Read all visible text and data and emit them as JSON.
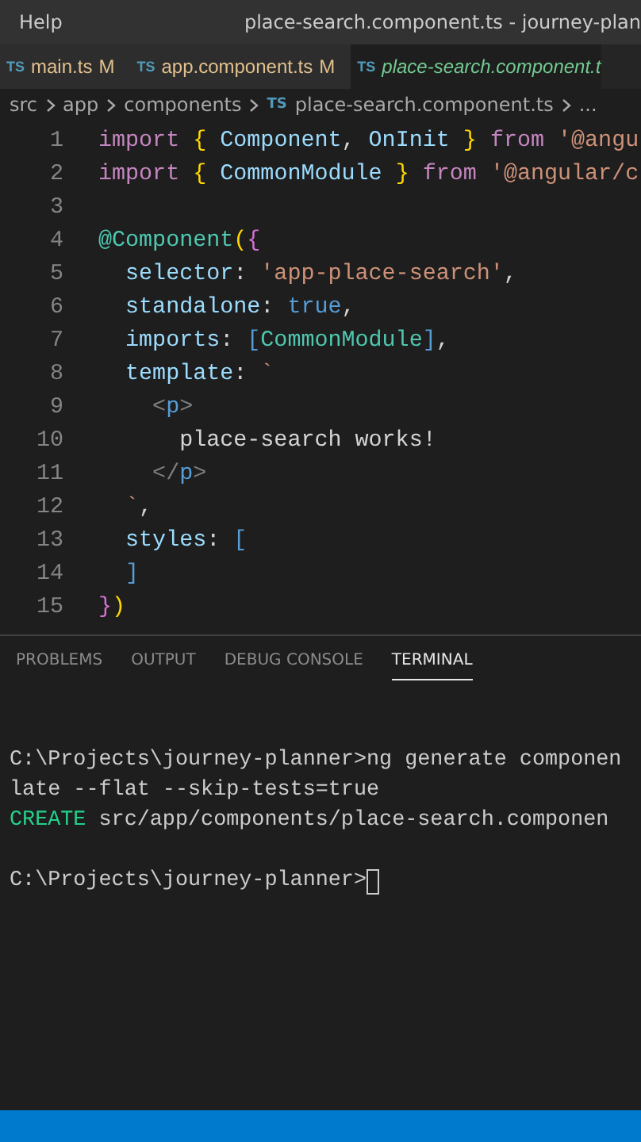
{
  "title_bar": {
    "menu": "Help",
    "title": "place-search.component.ts - journey-plan"
  },
  "tabs": [
    {
      "icon": "TS",
      "label": "main.ts",
      "badge": "M",
      "selected": false,
      "modified": true
    },
    {
      "icon": "TS",
      "label": "app.component.ts",
      "badge": "M",
      "selected": false,
      "modified": true
    },
    {
      "icon": "TS",
      "label": "place-search.component.t",
      "selected": true,
      "modified": false
    }
  ],
  "breadcrumb": {
    "parts": [
      "src",
      "app",
      "components"
    ],
    "file_icon": "TS",
    "file": "place-search.component.ts",
    "more": "..."
  },
  "editor": {
    "lines": [
      {
        "number": "1",
        "tokens": [
          {
            "kind": "kw",
            "text": "import "
          },
          {
            "kind": "brace",
            "text": "{ "
          },
          {
            "kind": "ident",
            "text": "Component"
          },
          {
            "kind": "punc",
            "text": ", "
          },
          {
            "kind": "ident",
            "text": "OnInit "
          },
          {
            "kind": "brace",
            "text": "} "
          },
          {
            "kind": "kw",
            "text": "from "
          },
          {
            "kind": "str",
            "text": "'@angu"
          }
        ]
      },
      {
        "number": "2",
        "tokens": [
          {
            "kind": "kw",
            "text": "import "
          },
          {
            "kind": "brace",
            "text": "{ "
          },
          {
            "kind": "ident",
            "text": "CommonModule "
          },
          {
            "kind": "brace",
            "text": "} "
          },
          {
            "kind": "kw",
            "text": "from "
          },
          {
            "kind": "str",
            "text": "'@angular/c"
          }
        ]
      },
      {
        "number": "3"
      },
      {
        "number": "4",
        "tokens": [
          {
            "kind": "cls",
            "text": "@Component"
          },
          {
            "kind": "brace",
            "text": "("
          },
          {
            "kind": "bracket",
            "text": "{"
          }
        ]
      },
      {
        "number": "5",
        "tokens": [
          {
            "kind": "ident",
            "text": "  selector"
          },
          {
            "kind": "punc",
            "text": ": "
          },
          {
            "kind": "str",
            "text": "'app-place-search'"
          },
          {
            "kind": "punc",
            "text": ","
          }
        ]
      },
      {
        "number": "6",
        "tokens": [
          {
            "kind": "ident",
            "text": "  standalone"
          },
          {
            "kind": "punc",
            "text": ": "
          },
          {
            "kind": "bool",
            "text": "true"
          },
          {
            "kind": "punc",
            "text": ","
          }
        ]
      },
      {
        "number": "7",
        "tokens": [
          {
            "kind": "ident",
            "text": "  imports"
          },
          {
            "kind": "punc",
            "text": ": "
          },
          {
            "kind": "bool",
            "text": "["
          },
          {
            "kind": "cls",
            "text": "CommonModule"
          },
          {
            "kind": "bool",
            "text": "]"
          },
          {
            "kind": "punc",
            "text": ","
          }
        ]
      },
      {
        "number": "8",
        "tokens": [
          {
            "kind": "ident",
            "text": "  template"
          },
          {
            "kind": "punc",
            "text": ": "
          },
          {
            "kind": "str",
            "text": "`"
          }
        ]
      },
      {
        "number": "9",
        "tokens": [
          {
            "kind": "tagp",
            "text": "    <"
          },
          {
            "kind": "tag",
            "text": "p"
          },
          {
            "kind": "tagp",
            "text": ">"
          }
        ]
      },
      {
        "number": "10",
        "tokens": [
          {
            "kind": "punc",
            "text": "      place-search works!"
          }
        ]
      },
      {
        "number": "11",
        "tokens": [
          {
            "kind": "tagp",
            "text": "    </"
          },
          {
            "kind": "tag",
            "text": "p"
          },
          {
            "kind": "tagp",
            "text": ">"
          }
        ]
      },
      {
        "number": "12",
        "tokens": [
          {
            "kind": "str",
            "text": "  `"
          },
          {
            "kind": "punc",
            "text": ","
          }
        ]
      },
      {
        "number": "13",
        "tokens": [
          {
            "kind": "ident",
            "text": "  styles"
          },
          {
            "kind": "punc",
            "text": ": "
          },
          {
            "kind": "bool",
            "text": "["
          }
        ]
      },
      {
        "number": "14",
        "tokens": [
          {
            "kind": "bool",
            "text": "  ]"
          }
        ]
      },
      {
        "number": "15",
        "tokens": [
          {
            "kind": "bracket",
            "text": "}"
          },
          {
            "kind": "brace",
            "text": ")"
          }
        ]
      }
    ]
  },
  "panel_tabs": [
    {
      "label": "PROBLEMS",
      "selected": false
    },
    {
      "label": "OUTPUT",
      "selected": false
    },
    {
      "label": "DEBUG CONSOLE",
      "selected": false
    },
    {
      "label": "TERMINAL",
      "selected": true
    }
  ],
  "terminal": {
    "lines": [
      {
        "kind": "blank"
      },
      {
        "kind": "text",
        "tokens": [
          {
            "kind": "plain",
            "text": "C:\\Projects\\journey-planner>ng generate componen"
          }
        ]
      },
      {
        "kind": "text",
        "tokens": [
          {
            "kind": "plain",
            "text": "late --flat --skip-tests=true"
          }
        ]
      },
      {
        "kind": "text",
        "tokens": [
          {
            "kind": "create",
            "text": "CREATE"
          },
          {
            "kind": "plain",
            "text": " src/app/components/place-search.componen"
          }
        ]
      },
      {
        "kind": "blank"
      },
      {
        "kind": "prompt",
        "tokens": [
          {
            "kind": "plain",
            "text": "C:\\Projects\\journey-planner>"
          }
        ]
      }
    ]
  }
}
